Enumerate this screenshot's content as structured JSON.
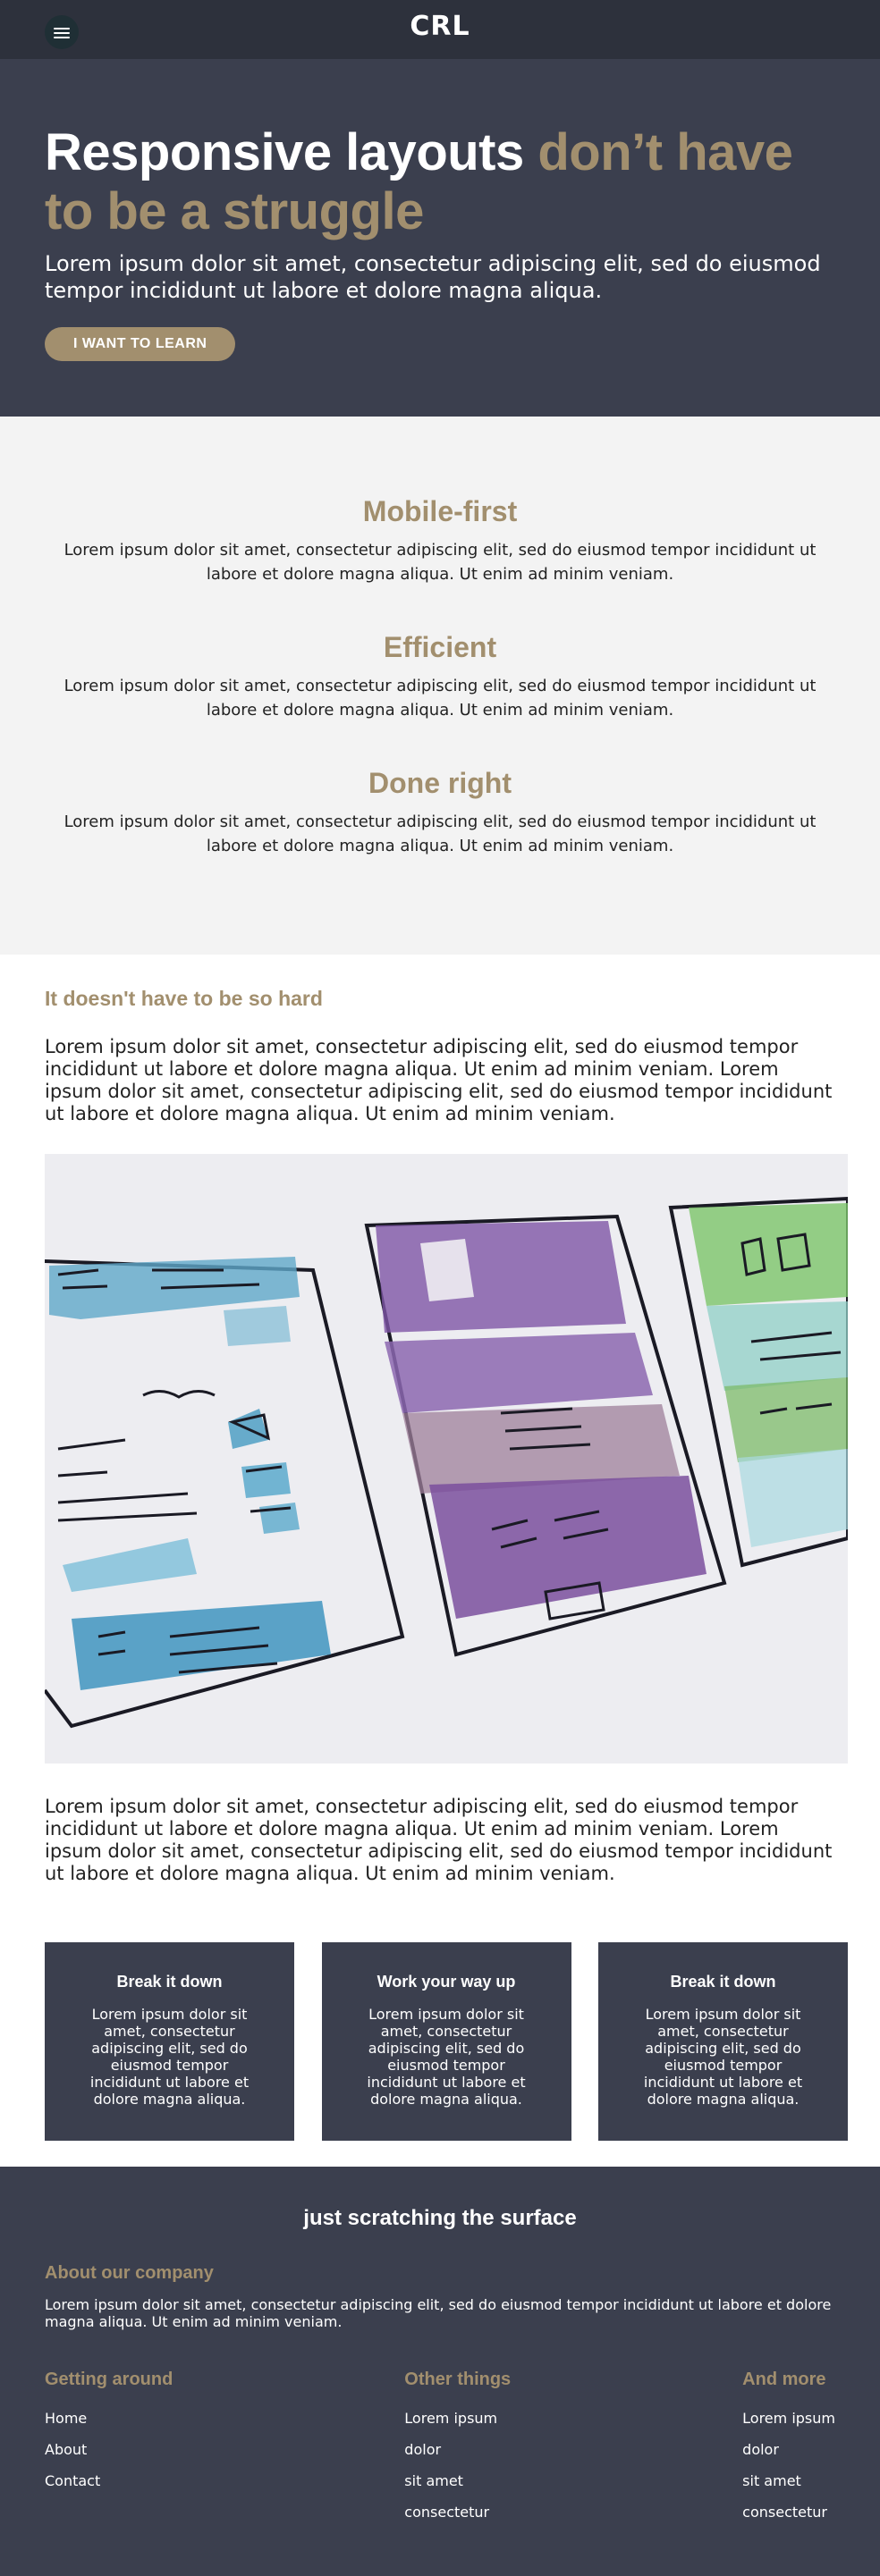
{
  "header": {
    "logo": "CRL"
  },
  "hero": {
    "title_plain": "Responsive layouts",
    "title_accent": " don’t have to be a struggle",
    "subtitle": "Lorem ipsum dolor sit amet, consectetur adipiscing elit, sed do eiusmod tempor incididunt ut labore et dolore magna aliqua.",
    "cta_label": "I WANT TO LEARN"
  },
  "features": [
    {
      "title": "Mobile-first",
      "text": "Lorem ipsum dolor sit amet, consectetur adipiscing elit, sed do eiusmod tempor incididunt ut labore et dolore magna aliqua. Ut enim ad minim veniam."
    },
    {
      "title": "Efficient",
      "text": "Lorem ipsum dolor sit amet, consectetur adipiscing elit, sed do eiusmod tempor incididunt ut labore et dolore magna aliqua. Ut enim ad minim veniam."
    },
    {
      "title": "Done right",
      "text": "Lorem ipsum dolor sit amet, consectetur adipiscing elit, sed do eiusmod tempor incididunt ut labore et dolore magna aliqua. Ut enim ad minim veniam."
    }
  ],
  "content": {
    "heading": "It doesn't have to be so hard",
    "para1": "Lorem ipsum dolor sit amet, consectetur adipiscing elit, sed do eiusmod tempor incididunt ut labore et dolore magna aliqua. Ut enim ad minim veniam. Lorem ipsum dolor sit amet, consectetur adipiscing elit, sed do eiusmod tempor incididunt ut labore et dolore magna aliqua. Ut enim ad minim veniam.",
    "para2": "Lorem ipsum dolor sit amet, consectetur adipiscing elit, sed do eiusmod tempor incididunt ut labore et dolore magna aliqua. Ut enim ad minim veniam. Lorem ipsum dolor sit amet, consectetur adipiscing elit, sed do eiusmod tempor incididunt ut labore et dolore magna aliqua. Ut enim ad minim veniam."
  },
  "cards": [
    {
      "title": "Break it down",
      "text": "Lorem ipsum dolor sit amet, consectetur adipiscing elit, sed do eiusmod tempor incididunt ut labore et dolore magna aliqua."
    },
    {
      "title": "Work your way up",
      "text": "Lorem ipsum dolor sit amet, consectetur adipiscing elit, sed do eiusmod tempor incididunt ut labore et dolore magna aliqua."
    },
    {
      "title": "Break it down",
      "text": "Lorem ipsum dolor sit amet, consectetur adipiscing elit, sed do eiusmod tempor incididunt ut labore et dolore magna aliqua."
    }
  ],
  "footer": {
    "tagline": "just scratching the surface",
    "about_title": "About our company",
    "about_text": "Lorem ipsum dolor sit amet, consectetur adipiscing elit, sed do eiusmod tempor incididunt ut labore et dolore magna aliqua. Ut enim ad minim veniam.",
    "columns": [
      {
        "title": "Getting around",
        "links": [
          "Home",
          "About",
          "Contact"
        ]
      },
      {
        "title": "Other things",
        "links": [
          "Lorem ipsum",
          "dolor",
          "sit amet",
          "consectetur"
        ]
      },
      {
        "title": "And more",
        "links": [
          "Lorem ipsum",
          "dolor",
          "sit amet",
          "consectetur"
        ]
      }
    ]
  },
  "colors": {
    "accent": "#a28f6e",
    "dark": "#3b3f4e",
    "header": "#2d313c",
    "light": "#f3f3f3"
  }
}
